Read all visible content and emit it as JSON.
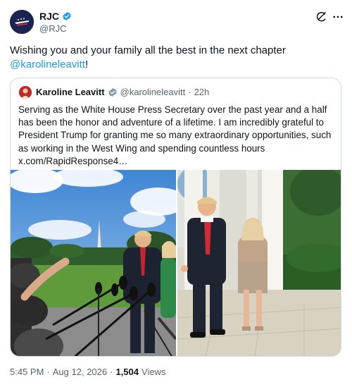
{
  "author": {
    "name": "RJC",
    "handle": "@RJC"
  },
  "tweet": {
    "text_prefix": "Wishing you and your family all the best in the next chapter",
    "mention": "@karolineleavitt",
    "text_suffix": "!"
  },
  "quote": {
    "name": "Karoline Leavitt",
    "handle": "@karolineleavitt",
    "separator": "·",
    "age": "22h",
    "text": "Serving as the White House Press Secretary over the past year and a half has been the honor and adventure of a lifetime. I am incredibly grateful to President Trump for granting me so many extraordinary opportunities, such as working in the West Wing and spending countless hours x.com/RapidResponse4…"
  },
  "footer": {
    "time": "5:45 PM",
    "dot": "·",
    "date": "Aug 12, 2026",
    "views_count": "1,504",
    "views_label": "Views"
  },
  "colors": {
    "accent": "#1d9bf0",
    "muted": "#536471",
    "border": "#cfd9de"
  },
  "icons": {
    "verified": "verified-badge-icon",
    "grok": "grok-icon",
    "more": "more-icon"
  }
}
